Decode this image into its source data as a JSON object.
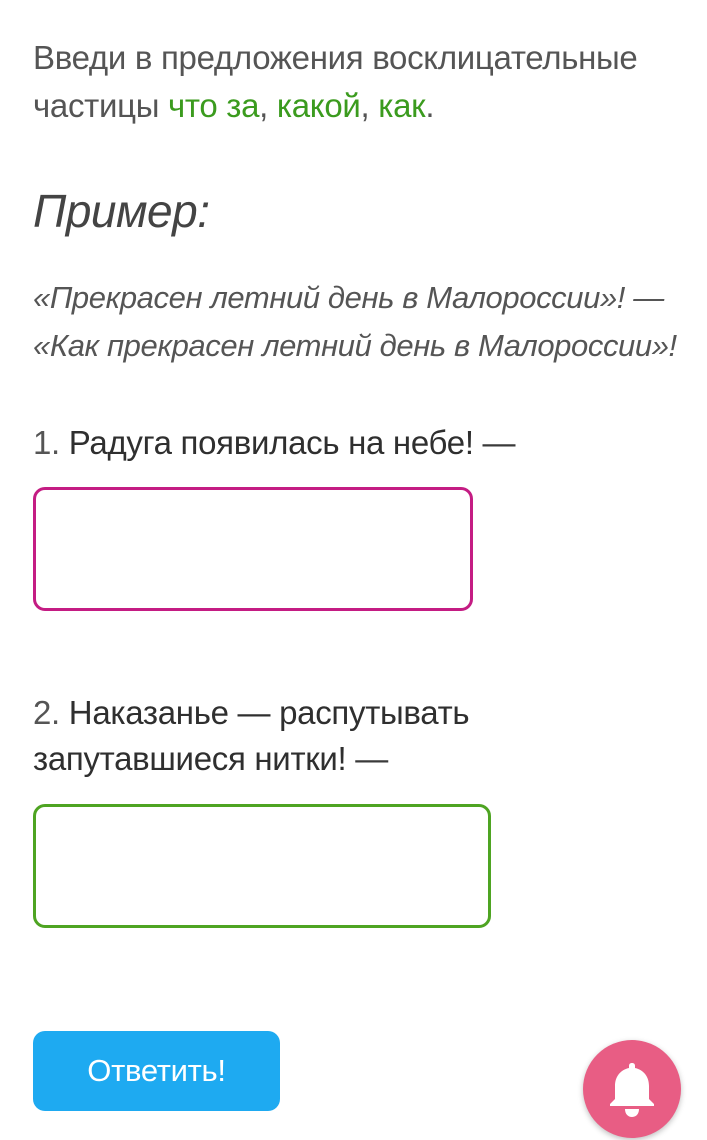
{
  "task": {
    "intro": "Введи в предложения восклицательные частицы ",
    "particle1": "что за",
    "sep1": ", ",
    "particle2": "какой",
    "sep2": ", ",
    "particle3": "как",
    "end": "."
  },
  "example": {
    "title": "Пример:",
    "line1": "«Прекрасен летний день в Малороссии»! —",
    "line2": "«Как прекрасен летний день в Малороссии»!"
  },
  "questions": [
    {
      "number": "1. ",
      "sentence": "Радуга появилась на небе!",
      "dash": " —",
      "answer_value": ""
    },
    {
      "number": "2. ",
      "sentence": "Наказанье — распутывать запутавшиеся нитки!",
      "dash": " —",
      "answer_value": ""
    }
  ],
  "submit": {
    "label": "Ответить!"
  },
  "notifications": {
    "icon": "bell-icon"
  },
  "colors": {
    "particle_green": "#3b9b1e",
    "answer1_border": "#c41c83",
    "answer2_border": "#4ea422",
    "submit_bg": "#1eaaf1",
    "bell_bg": "#e85d84"
  }
}
